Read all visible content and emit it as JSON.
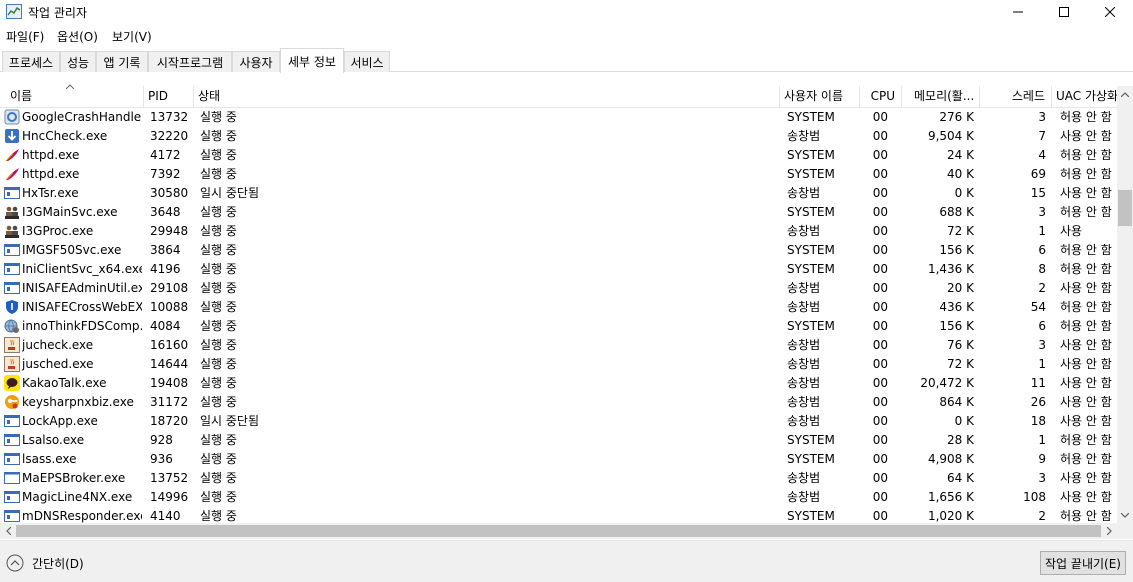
{
  "window": {
    "title": "작업 관리자"
  },
  "menu": [
    "파일(F)",
    "옵션(O)",
    "보기(V)"
  ],
  "tabs": [
    "프로세스",
    "성능",
    "앱 기록",
    "시작프로그램",
    "사용자",
    "세부 정보",
    "서비스"
  ],
  "active_tab": "세부 정보",
  "columns": [
    "이름",
    "PID",
    "상태",
    "사용자 이름",
    "CPU",
    "메모리(활...",
    "스레드",
    "UAC 가상화"
  ],
  "rows": [
    {
      "name": "GoogleCrashHandler...",
      "pid": "13732",
      "status": "실행 중",
      "user": "SYSTEM",
      "cpu": "00",
      "mem": "276 K",
      "threads": "3",
      "uac": "허용 안 함",
      "icon": "google-crash-icon"
    },
    {
      "name": "HncCheck.exe",
      "pid": "32220",
      "status": "실행 중",
      "user": "송창범",
      "cpu": "00",
      "mem": "9,504 K",
      "threads": "7",
      "uac": "사용 안 함",
      "icon": "hnc-download-icon"
    },
    {
      "name": "httpd.exe",
      "pid": "4172",
      "status": "실행 중",
      "user": "SYSTEM",
      "cpu": "00",
      "mem": "24 K",
      "threads": "4",
      "uac": "허용 안 함",
      "icon": "apache-feather-icon"
    },
    {
      "name": "httpd.exe",
      "pid": "7392",
      "status": "실행 중",
      "user": "SYSTEM",
      "cpu": "00",
      "mem": "40 K",
      "threads": "69",
      "uac": "허용 안 함",
      "icon": "apache-feather-icon"
    },
    {
      "name": "HxTsr.exe",
      "pid": "30580",
      "status": "일시 중단됨",
      "user": "송창범",
      "cpu": "00",
      "mem": "0 K",
      "threads": "15",
      "uac": "사용 안 함",
      "icon": "app-window-icon"
    },
    {
      "name": "I3GMainSvc.exe",
      "pid": "3648",
      "status": "실행 중",
      "user": "SYSTEM",
      "cpu": "00",
      "mem": "688 K",
      "threads": "3",
      "uac": "허용 안 함",
      "icon": "i3g-people-icon"
    },
    {
      "name": "I3GProc.exe",
      "pid": "29948",
      "status": "실행 중",
      "user": "송창범",
      "cpu": "00",
      "mem": "72 K",
      "threads": "1",
      "uac": "사용",
      "icon": "i3g-people-icon"
    },
    {
      "name": "IMGSF50Svc.exe",
      "pid": "3864",
      "status": "실행 중",
      "user": "SYSTEM",
      "cpu": "00",
      "mem": "156 K",
      "threads": "6",
      "uac": "허용 안 함",
      "icon": "app-window-icon"
    },
    {
      "name": "IniClientSvc_x64.exe",
      "pid": "4196",
      "status": "실행 중",
      "user": "SYSTEM",
      "cpu": "00",
      "mem": "1,436 K",
      "threads": "8",
      "uac": "허용 안 함",
      "icon": "app-window-icon"
    },
    {
      "name": "INISAFEAdminUtil.exe",
      "pid": "29108",
      "status": "실행 중",
      "user": "송창범",
      "cpu": "00",
      "mem": "20 K",
      "threads": "2",
      "uac": "사용 안 함",
      "icon": "app-window-icon"
    },
    {
      "name": "INISAFECrossWebEX...",
      "pid": "10088",
      "status": "실행 중",
      "user": "송창범",
      "cpu": "00",
      "mem": "436 K",
      "threads": "54",
      "uac": "허용 안 함",
      "icon": "shield-icon"
    },
    {
      "name": "innoThinkFDSComp...",
      "pid": "4084",
      "status": "실행 중",
      "user": "SYSTEM",
      "cpu": "00",
      "mem": "156 K",
      "threads": "6",
      "uac": "허용 안 함",
      "icon": "globe-gear-icon"
    },
    {
      "name": "jucheck.exe",
      "pid": "16160",
      "status": "실행 중",
      "user": "송창범",
      "cpu": "00",
      "mem": "76 K",
      "threads": "3",
      "uac": "사용 안 함",
      "icon": "java-icon"
    },
    {
      "name": "jusched.exe",
      "pid": "14644",
      "status": "실행 중",
      "user": "송창범",
      "cpu": "00",
      "mem": "72 K",
      "threads": "1",
      "uac": "사용 안 함",
      "icon": "java-icon"
    },
    {
      "name": "KakaoTalk.exe",
      "pid": "19408",
      "status": "실행 중",
      "user": "송창범",
      "cpu": "00",
      "mem": "20,472 K",
      "threads": "11",
      "uac": "사용 안 함",
      "icon": "kakaotalk-icon"
    },
    {
      "name": "keysharpnxbiz.exe",
      "pid": "31172",
      "status": "실행 중",
      "user": "송창범",
      "cpu": "00",
      "mem": "864 K",
      "threads": "26",
      "uac": "사용 안 함",
      "icon": "keysharp-icon"
    },
    {
      "name": "LockApp.exe",
      "pid": "18720",
      "status": "일시 중단됨",
      "user": "송창범",
      "cpu": "00",
      "mem": "0 K",
      "threads": "18",
      "uac": "사용 안 함",
      "icon": "app-window-icon"
    },
    {
      "name": "Lsalso.exe",
      "pid": "928",
      "status": "실행 중",
      "user": "SYSTEM",
      "cpu": "00",
      "mem": "28 K",
      "threads": "1",
      "uac": "허용 안 함",
      "icon": "app-window-icon"
    },
    {
      "name": "lsass.exe",
      "pid": "936",
      "status": "실행 중",
      "user": "SYSTEM",
      "cpu": "00",
      "mem": "4,908 K",
      "threads": "9",
      "uac": "허용 안 함",
      "icon": "app-window-icon"
    },
    {
      "name": "MaEPSBroker.exe",
      "pid": "13752",
      "status": "실행 중",
      "user": "송창범",
      "cpu": "00",
      "mem": "64 K",
      "threads": "3",
      "uac": "사용 안 함",
      "icon": "blank-window-icon"
    },
    {
      "name": "MagicLine4NX.exe",
      "pid": "14996",
      "status": "실행 중",
      "user": "송창범",
      "cpu": "00",
      "mem": "1,656 K",
      "threads": "108",
      "uac": "사용 안 함",
      "icon": "app-window-icon"
    },
    {
      "name": "mDNSResponder.exe",
      "pid": "4140",
      "status": "실행 중",
      "user": "SYSTEM",
      "cpu": "00",
      "mem": "1,020 K",
      "threads": "2",
      "uac": "허용 안 함",
      "icon": "app-window-icon"
    }
  ],
  "footer": {
    "fewer_details": "간단히(D)",
    "end_task": "작업 끝내기(E)"
  }
}
